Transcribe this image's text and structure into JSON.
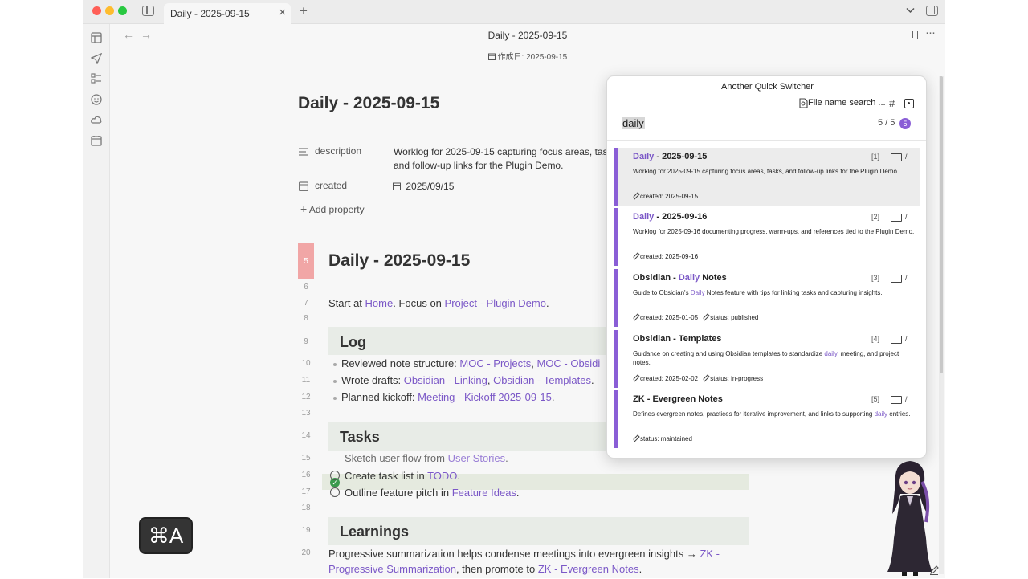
{
  "window": {
    "tab_title": "Daily - 2025-09-15",
    "view_title": "Daily - 2025-09-15",
    "created_banner": "作成日: 2025-09-15",
    "keystroke_badge": "⌘A"
  },
  "note": {
    "title": "Daily - 2025-09-15",
    "properties": {
      "description_key": "description",
      "description_value": "Worklog for 2025-09-15 capturing focus areas, tasks, and follow-up links for the Plugin Demo.",
      "created_key": "created",
      "created_value": "2025/09/15",
      "add_property": "Add property"
    },
    "line_numbers": [
      "5",
      "6",
      "7",
      "8",
      "9",
      "10",
      "11",
      "12",
      "13",
      "14",
      "15",
      "16",
      "17",
      "18",
      "19",
      "20"
    ],
    "heading1": "Daily - 2025-09-15",
    "start_line": {
      "prefix": "Start at ",
      "link1": "Home",
      "middle": ". Focus on ",
      "link2": "Project - Plugin Demo",
      "suffix": "."
    },
    "log": {
      "heading": "Log",
      "item1": {
        "prefix": "Reviewed note structure: ",
        "link1": "MOC - Projects",
        "sep": ", ",
        "link2": "MOC - Obsidi"
      },
      "item2": {
        "prefix": "Wrote drafts: ",
        "link1": "Obsidian - Linking",
        "sep": ", ",
        "link2": "Obsidian - Templates",
        "suffix": "."
      },
      "item3": {
        "prefix": "Planned kickoff: ",
        "link1": "Meeting - Kickoff 2025-09-15",
        "suffix": "."
      }
    },
    "tasks": {
      "heading": "Tasks",
      "task1": {
        "prefix": "Sketch user flow from ",
        "link": "User Stories",
        "suffix": ".",
        "done": true
      },
      "task2": {
        "prefix": "Create task list in ",
        "link": "TODO",
        "suffix": ".",
        "done": false
      },
      "task3": {
        "prefix": "Outline feature pitch in ",
        "link": "Feature Ideas",
        "suffix": ".",
        "done": false
      }
    },
    "learnings": {
      "heading": "Learnings",
      "line1_prefix": "Progressive summarization helps condense meetings into evergreen insights → ",
      "line1_link": "ZK -",
      "line2_link1": "Progressive Summarization",
      "line2_middle": ", then promote to ",
      "line2_link2": "ZK - Evergreen Notes",
      "line2_suffix": "."
    }
  },
  "switcher": {
    "title": "Another Quick Switcher",
    "mode": "File name search ...",
    "hash_icon": "#",
    "query": "daily",
    "count": "5 / 5",
    "badge": "5",
    "results": [
      {
        "title_hl": "Daily",
        "title_rest": " - 2025-09-15",
        "num": "[1]",
        "folder": "/",
        "desc": "Worklog for 2025-09-15 capturing focus areas, tasks, and follow-up links for the Plugin Demo.",
        "meta1": "created: 2025-09-15",
        "meta2": ""
      },
      {
        "title_hl": "Daily",
        "title_rest": " - 2025-09-16",
        "num": "[2]",
        "folder": "/",
        "desc": "Worklog for 2025-09-16 documenting progress, warm-ups, and references tied to the Plugin Demo.",
        "meta1": "created: 2025-09-16",
        "meta2": ""
      },
      {
        "title_pre": "Obsidian - ",
        "title_hl": "Daily",
        "title_rest": " Notes",
        "num": "[3]",
        "folder": "/",
        "desc_pre": "Guide to Obsidian's ",
        "desc_hl": "Daily",
        "desc_rest": " Notes feature with tips for linking tasks and capturing insights.",
        "meta1": "created: 2025-01-05",
        "meta2": "status: published"
      },
      {
        "title_rest": "Obsidian - Templates",
        "num": "[4]",
        "folder": "/",
        "desc_pre": "Guidance on creating and using Obsidian templates to standardize ",
        "desc_hl": "daily",
        "desc_rest": ", meeting, and project notes.",
        "meta1": "created: 2025-02-02",
        "meta2": "status: in-progress"
      },
      {
        "title_rest": "ZK - Evergreen Notes",
        "num": "[5]",
        "folder": "/",
        "desc_pre": "Defines evergreen notes, practices for iterative improvement, and links to supporting ",
        "desc_hl": "daily",
        "desc_rest": " entries.",
        "meta1": "status: maintained"
      }
    ]
  },
  "colors": {
    "accent": "#7b58c7",
    "badge": "#8a5ed6",
    "active_line": "#f1a6a6",
    "heading_bg": "#e8ece7",
    "task_done": "#3a9a4c"
  }
}
